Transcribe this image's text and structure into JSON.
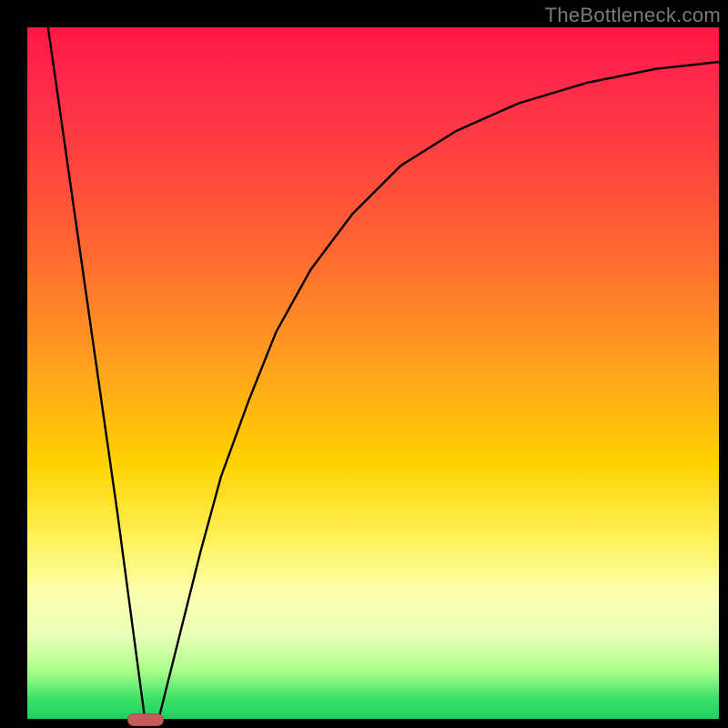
{
  "watermark": "TheBottleneck.com",
  "chart_data": {
    "type": "line",
    "title": "",
    "xlabel": "",
    "ylabel": "",
    "xlim": [
      0,
      100
    ],
    "ylim": [
      0,
      100
    ],
    "grid": false,
    "notes": "Background is a vertical heat gradient (red at top = 100, green at bottom = 0). Two black curves meet at a minimum near x≈17. A small red pill marks the minimum at (x≈17, y≈0).",
    "series": [
      {
        "name": "left-descending",
        "x": [
          3,
          5,
          7,
          9,
          11,
          13,
          15,
          17
        ],
        "values": [
          100,
          86,
          72,
          58,
          44,
          30,
          15,
          0
        ]
      },
      {
        "name": "right-ascending",
        "x": [
          19,
          22,
          25,
          28,
          32,
          36,
          41,
          47,
          54,
          62,
          71,
          81,
          91,
          100
        ],
        "values": [
          0,
          12,
          24,
          35,
          46,
          56,
          65,
          73,
          80,
          85,
          89,
          92,
          94,
          95
        ]
      }
    ],
    "marker": {
      "x": 17,
      "y": 0,
      "w": 5,
      "h": 1.5
    }
  }
}
